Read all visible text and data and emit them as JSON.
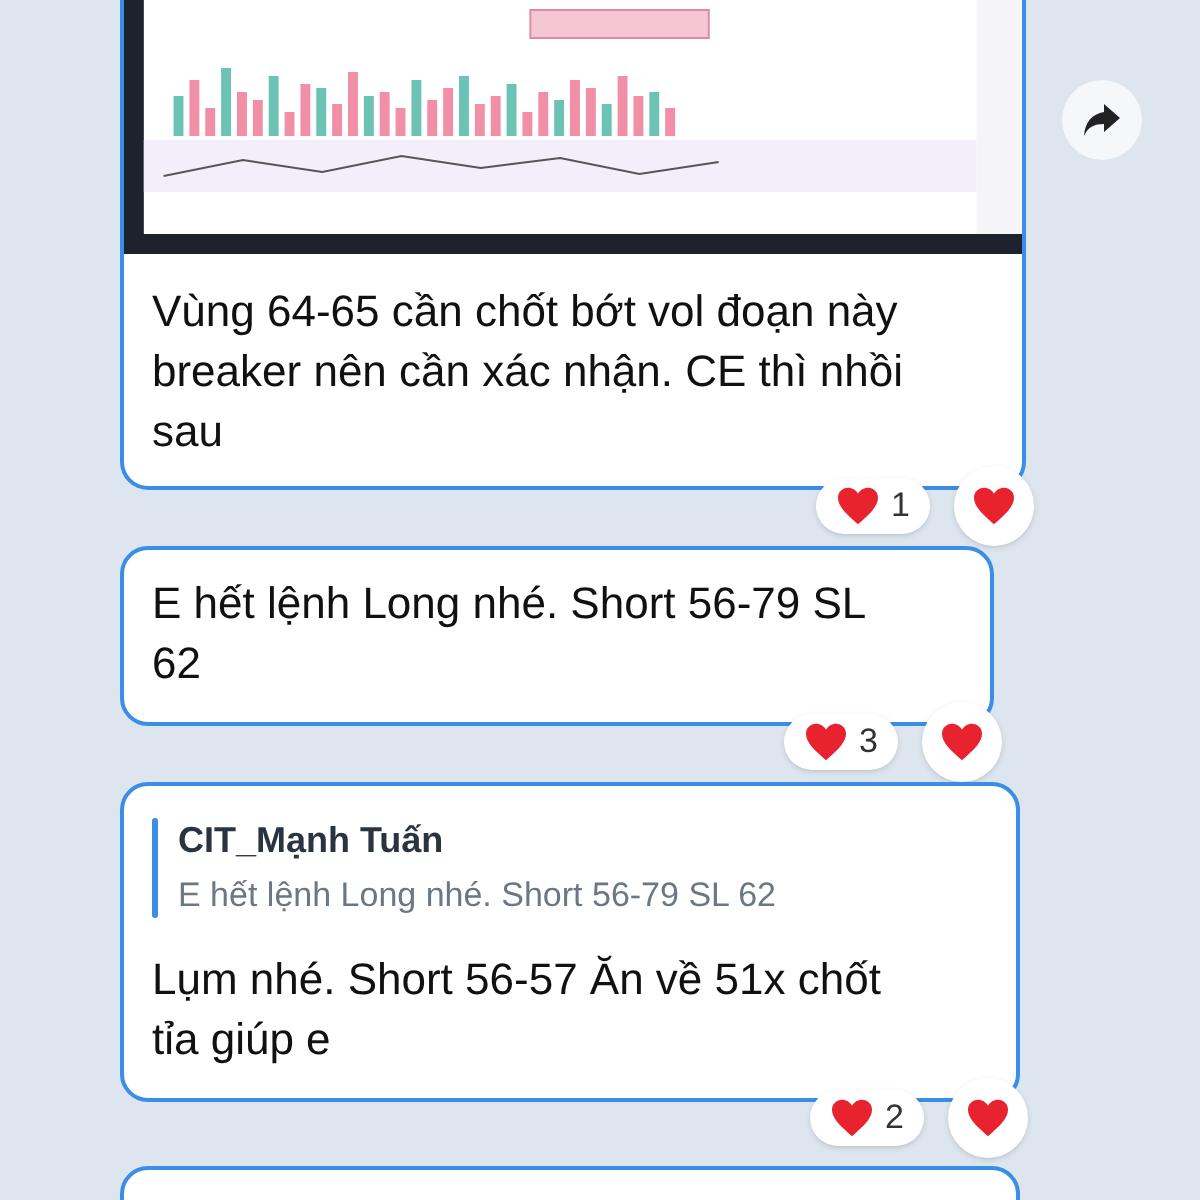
{
  "messages": [
    {
      "text": "Vùng 64-65 cần chốt bớt vol đoạn này breaker nên cần xác nhận. CE thì nhồi sau",
      "reaction_count": "1",
      "forward": true
    },
    {
      "text": "E hết lệnh Long nhé. Short 56-79 SL 62",
      "reaction_count": "3",
      "forward": false
    },
    {
      "reply": {
        "author": "CIT_Mạnh Tuấn",
        "text": "E hết lệnh Long nhé. Short 56-79 SL 62"
      },
      "text": "Lụm nhé. Short 56-57 Ăn về 51x chốt tỉa giúp e",
      "reaction_count": "2",
      "forward": false
    }
  ]
}
